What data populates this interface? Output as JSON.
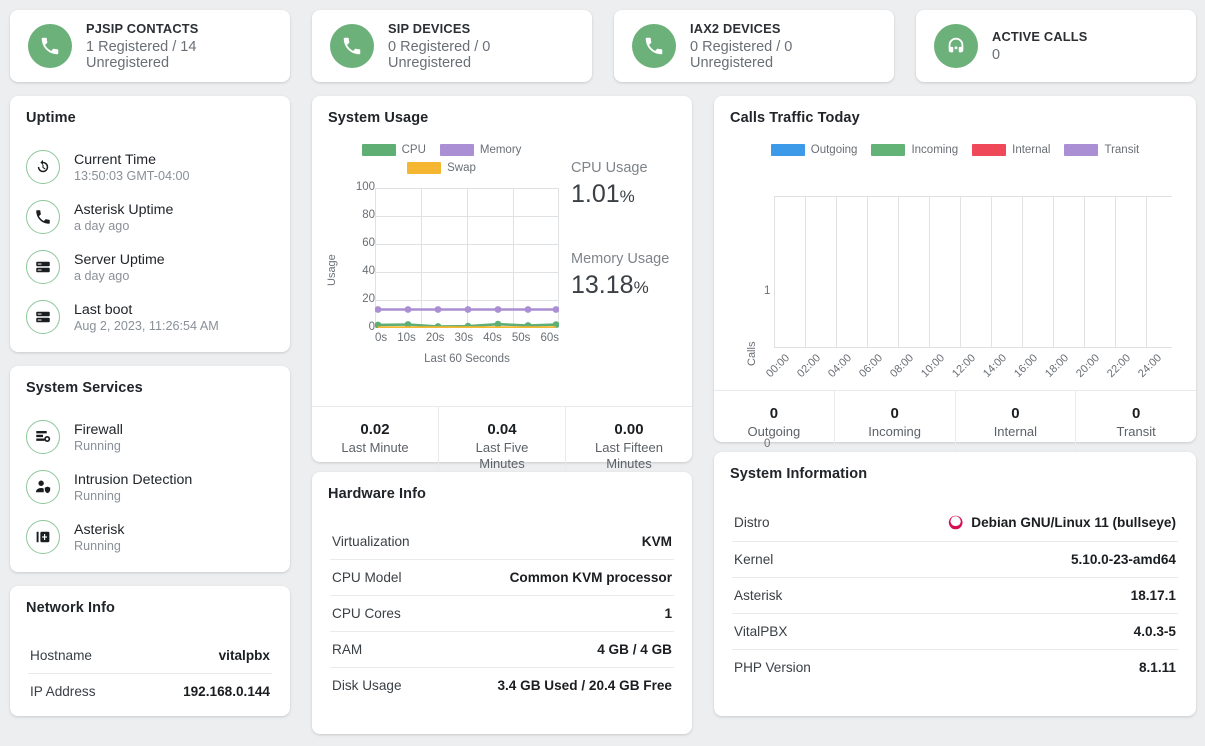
{
  "stat_cards": [
    {
      "icon": "phone-icon",
      "label": "PJSIP CONTACTS",
      "value": "1 Registered / 14 Unregistered"
    },
    {
      "icon": "phone-icon",
      "label": "SIP DEVICES",
      "value": "0 Registered / 0 Unregistered"
    },
    {
      "icon": "phone-icon",
      "label": "IAX2 DEVICES",
      "value": "0 Registered / 0 Unregistered"
    },
    {
      "icon": "headset-icon",
      "label": "ACTIVE CALLS",
      "value": "0"
    }
  ],
  "uptime": {
    "title": "Uptime",
    "items": [
      {
        "icon": "clock-rotate-icon",
        "title": "Current Time",
        "sub": "13:50:03 GMT-04:00"
      },
      {
        "icon": "phone-icon",
        "title": "Asterisk Uptime",
        "sub": "a day ago"
      },
      {
        "icon": "server-icon",
        "title": "Server Uptime",
        "sub": "a day ago"
      },
      {
        "icon": "server-icon",
        "title": "Last boot",
        "sub": "Aug 2, 2023, 11:26:54 AM"
      }
    ]
  },
  "system_services": {
    "title": "System Services",
    "items": [
      {
        "icon": "firewall-icon",
        "title": "Firewall",
        "sub": "Running"
      },
      {
        "icon": "user-shield-icon",
        "title": "Intrusion Detection",
        "sub": "Running"
      },
      {
        "icon": "asterisk-icon",
        "title": "Asterisk",
        "sub": "Running"
      }
    ]
  },
  "network_info": {
    "title": "Network Info",
    "rows": [
      {
        "key": "Hostname",
        "value": "vitalpbx"
      },
      {
        "key": "IP Address",
        "value": "192.168.0.144"
      }
    ]
  },
  "system_usage": {
    "title": "System Usage",
    "cpu_label": "CPU Usage",
    "cpu_value": "1.01",
    "memory_label": "Memory Usage",
    "memory_value": "13.18",
    "percent_sign": "%",
    "load": [
      {
        "value": "0.02",
        "caption": "Last Minute"
      },
      {
        "value": "0.04",
        "caption": "Last Five Minutes"
      },
      {
        "value": "0.00",
        "caption": "Last Fifteen Minutes"
      }
    ]
  },
  "calls_traffic": {
    "title": "Calls Traffic Today",
    "totals": [
      {
        "value": "0",
        "caption": "Outgoing"
      },
      {
        "value": "0",
        "caption": "Incoming"
      },
      {
        "value": "0",
        "caption": "Internal"
      },
      {
        "value": "0",
        "caption": "Transit"
      }
    ]
  },
  "hardware_info": {
    "title": "Hardware Info",
    "rows": [
      {
        "key": "Virtualization",
        "value": "KVM"
      },
      {
        "key": "CPU Model",
        "value": "Common KVM processor"
      },
      {
        "key": "CPU Cores",
        "value": "1"
      },
      {
        "key": "RAM",
        "value": "4 GB / 4 GB"
      },
      {
        "key": "Disk Usage",
        "value": "3.4 GB Used / 20.4 GB Free"
      }
    ]
  },
  "system_information": {
    "title": "System Information",
    "rows": [
      {
        "key": "Distro",
        "value": "Debian GNU/Linux 11 (bullseye)",
        "icon": "debian-logo-icon"
      },
      {
        "key": "Kernel",
        "value": "5.10.0-23-amd64"
      },
      {
        "key": "Asterisk",
        "value": "18.17.1"
      },
      {
        "key": "VitalPBX",
        "value": "4.0.3-5"
      },
      {
        "key": "PHP Version",
        "value": "8.1.11"
      }
    ]
  },
  "colors": {
    "accent_green": "#6cb07a",
    "ring_green": "#8ec79a",
    "cpu": "#5fae74",
    "memory": "#ab8fd4",
    "swap": "#f5b731",
    "outgoing": "#3c9ae8",
    "incoming": "#63b377",
    "internal": "#ef4858",
    "transit": "#ab8fd4",
    "debian_red": "#d70a53",
    "page_background": "#eceef0"
  },
  "chart_data": [
    {
      "type": "line",
      "title": "System Usage",
      "xlabel": "Last 60 Seconds",
      "ylabel": "Usage",
      "ylim": [
        0,
        100
      ],
      "yticks": [
        0,
        20,
        40,
        60,
        80,
        100
      ],
      "categories": [
        "0s",
        "10s",
        "20s",
        "30s",
        "40s",
        "50s",
        "60s"
      ],
      "grid": true,
      "legend_position": "top",
      "series": [
        {
          "name": "CPU",
          "color": "#5fae74",
          "values": [
            1.5,
            1.8,
            0.9,
            1.0,
            2.0,
            1.2,
            1.8
          ]
        },
        {
          "name": "Memory",
          "color": "#ab8fd4",
          "values": [
            13.2,
            13.2,
            13.2,
            13.2,
            13.2,
            13.2,
            13.2
          ]
        },
        {
          "name": "Swap",
          "color": "#f5b731",
          "values": [
            0,
            0,
            0,
            0,
            0,
            0,
            0
          ]
        }
      ]
    },
    {
      "type": "bar",
      "title": "Calls Traffic Today",
      "xlabel": "",
      "ylabel": "Calls",
      "ylim": [
        0,
        1
      ],
      "yticks": [
        0,
        1
      ],
      "categories": [
        "00:00",
        "02:00",
        "04:00",
        "06:00",
        "08:00",
        "10:00",
        "12:00",
        "14:00",
        "16:00",
        "18:00",
        "20:00",
        "22:00",
        "24:00"
      ],
      "grid": true,
      "legend_position": "top",
      "series": [
        {
          "name": "Outgoing",
          "color": "#3c9ae8",
          "values": [
            0,
            0,
            0,
            0,
            0,
            0,
            0,
            0,
            0,
            0,
            0,
            0,
            0
          ]
        },
        {
          "name": "Incoming",
          "color": "#63b377",
          "values": [
            0,
            0,
            0,
            0,
            0,
            0,
            0,
            0,
            0,
            0,
            0,
            0,
            0
          ]
        },
        {
          "name": "Internal",
          "color": "#ef4858",
          "values": [
            0,
            0,
            0,
            0,
            0,
            0,
            0,
            0,
            0,
            0,
            0,
            0,
            0
          ]
        },
        {
          "name": "Transit",
          "color": "#ab8fd4",
          "values": [
            0,
            0,
            0,
            0,
            0,
            0,
            0,
            0,
            0,
            0,
            0,
            0,
            0
          ]
        }
      ]
    }
  ]
}
